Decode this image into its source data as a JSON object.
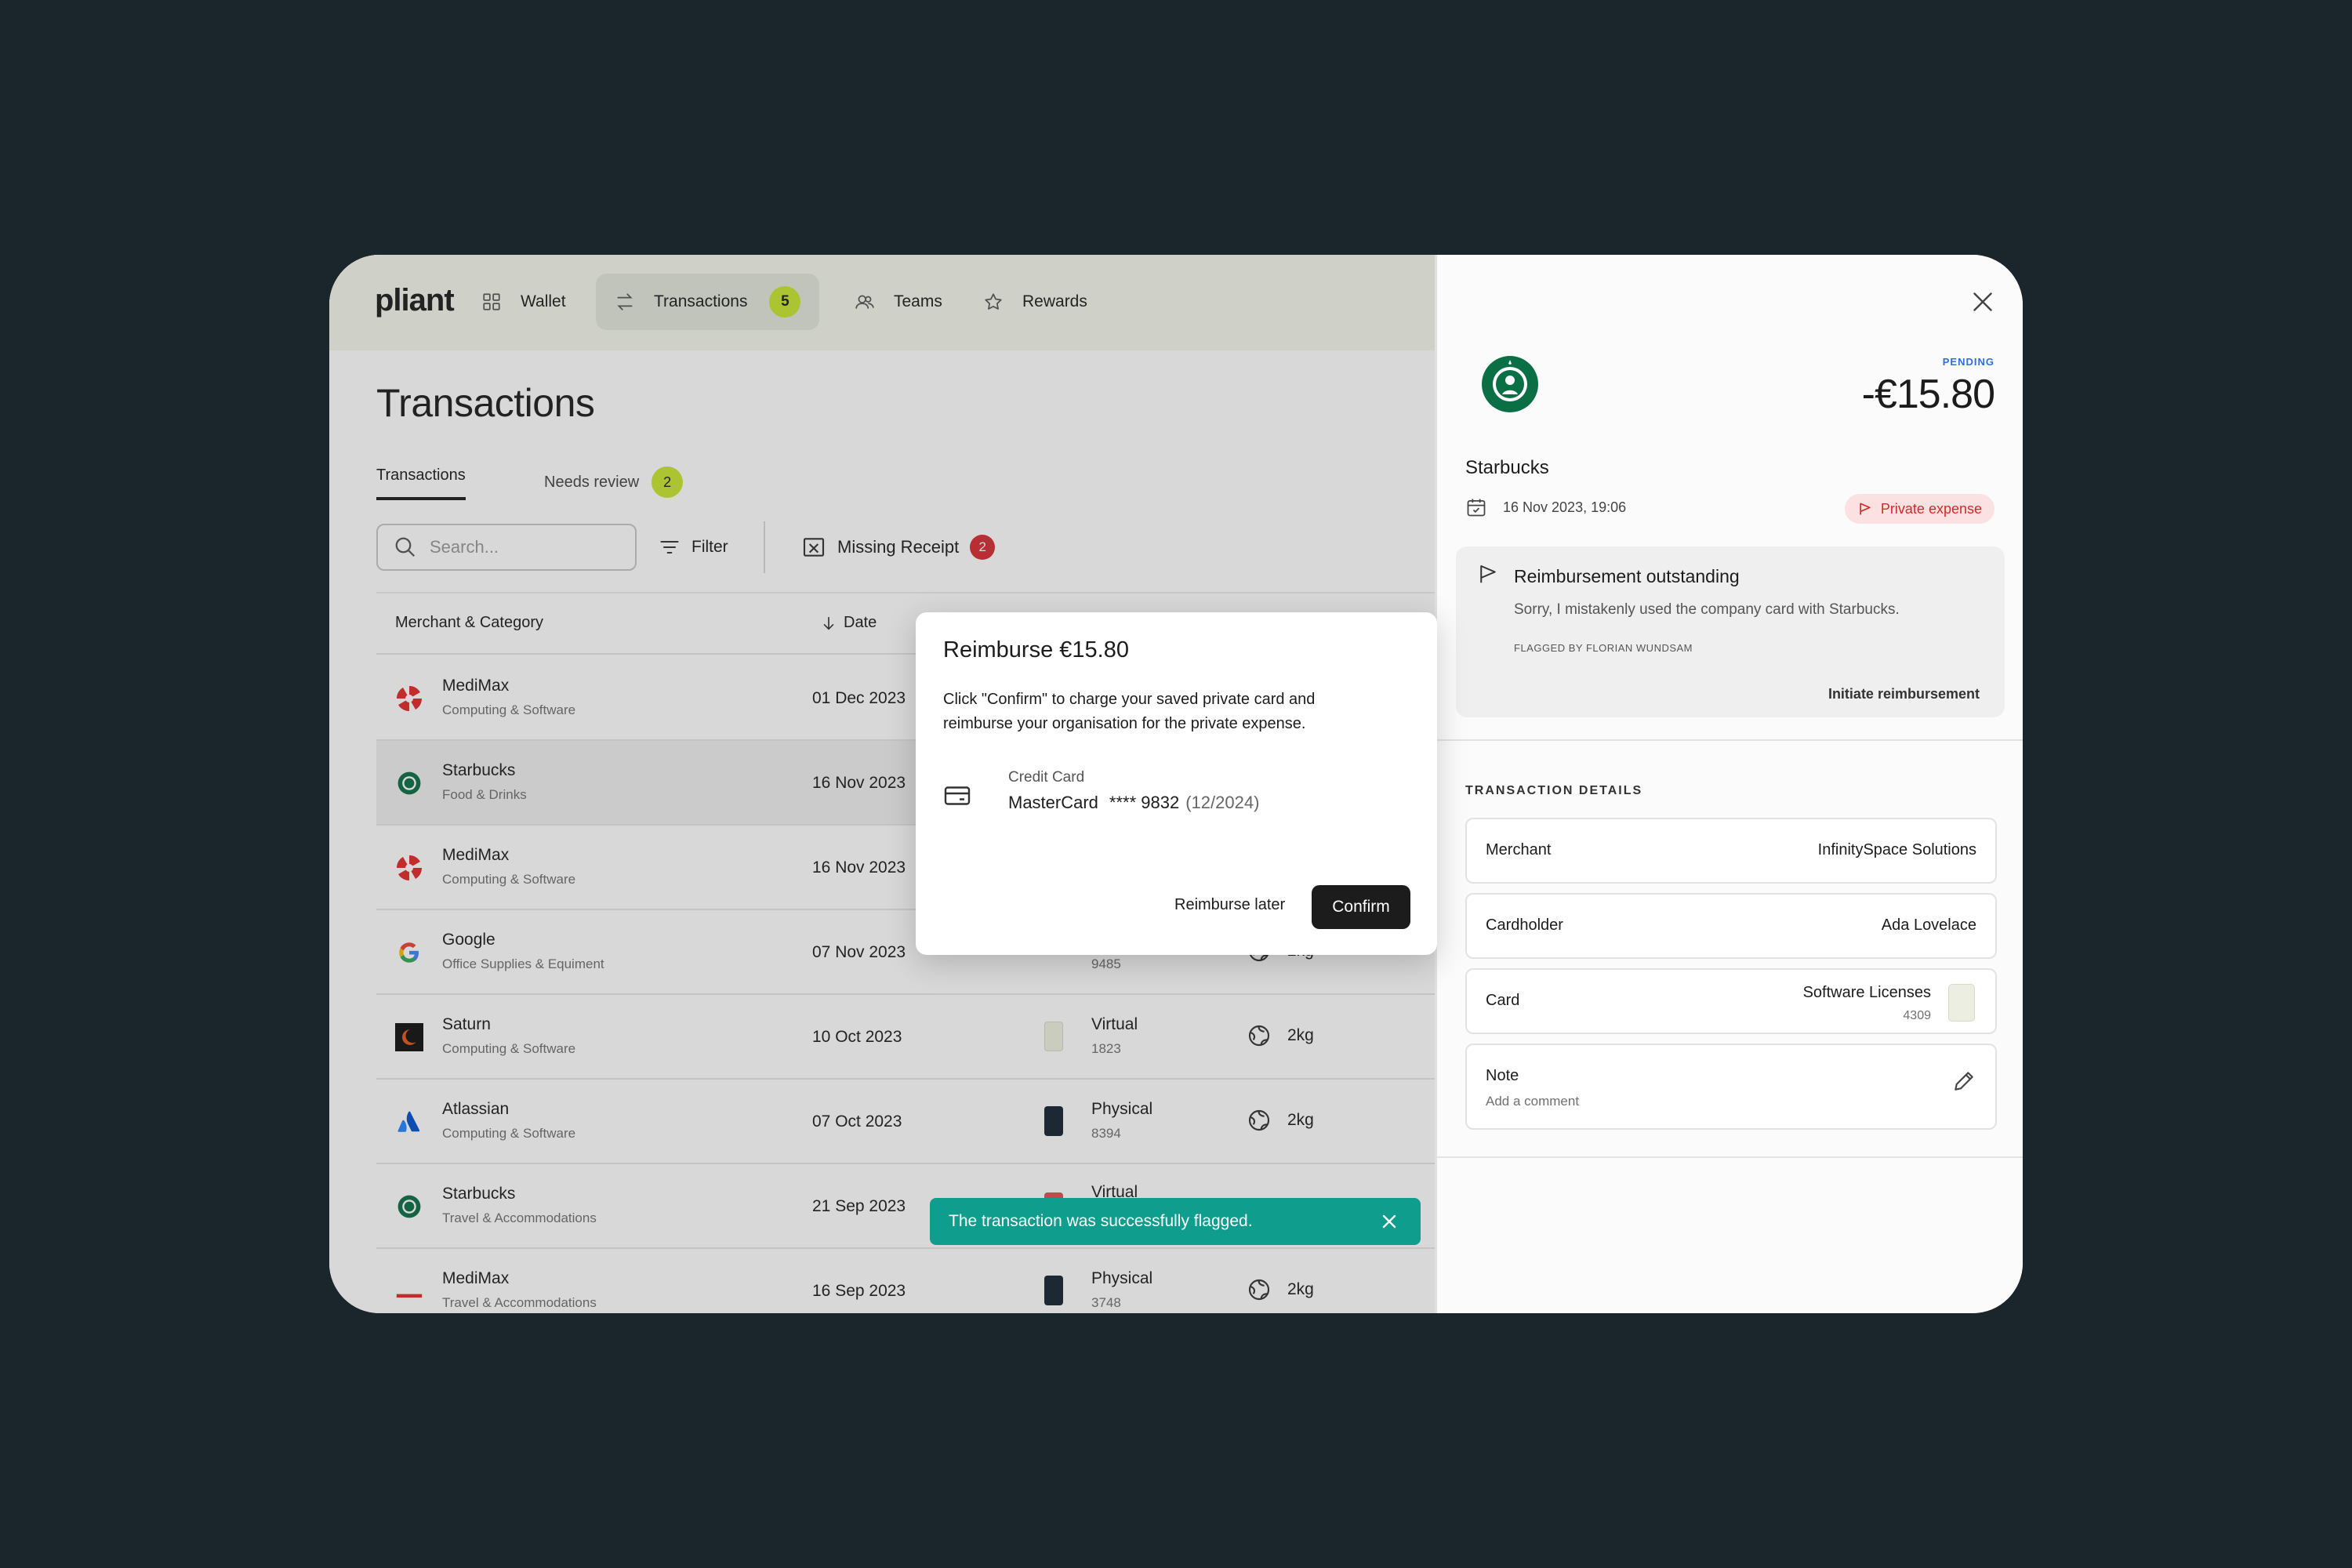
{
  "brand": "pliant",
  "nav": [
    {
      "label": "Wallet",
      "icon": "grid-icon"
    },
    {
      "label": "Transactions",
      "icon": "arrows-swap-icon",
      "badge": "5",
      "active": true
    },
    {
      "label": "Teams",
      "icon": "users-icon"
    },
    {
      "label": "Rewards",
      "icon": "star-icon"
    }
  ],
  "page": {
    "title": "Transactions",
    "tabs": {
      "transactions": "Transactions",
      "needs_review": "Needs review",
      "needs_review_count": "2"
    },
    "search_placeholder": "Search...",
    "filter_label": "Filter",
    "missing_receipt_label": "Missing Receipt",
    "missing_receipt_count": "2"
  },
  "table": {
    "headers": {
      "merchant": "Merchant & Category",
      "date": "Date"
    },
    "rows": [
      {
        "merchant": "MediMax",
        "category": "Computing & Software",
        "date": "01 Dec 2023",
        "card_type": "",
        "card_num": "",
        "co2": ""
      },
      {
        "merchant": "Starbucks",
        "category": "Food & Drinks",
        "date": "16 Nov 2023",
        "card_type": "",
        "card_num": "",
        "co2": ""
      },
      {
        "merchant": "MediMax",
        "category": "Computing & Software",
        "date": "16 Nov 2023",
        "card_type": "",
        "card_num": "",
        "co2": ""
      },
      {
        "merchant": "Google",
        "category": "Office Supplies & Equiment",
        "date": "07 Nov 2023",
        "card_type": "",
        "card_num": "9485",
        "co2": "2kg"
      },
      {
        "merchant": "Saturn",
        "category": "Computing & Software",
        "date": "10 Oct 2023",
        "card_type": "Virtual",
        "card_num": "1823",
        "co2": "2kg"
      },
      {
        "merchant": "Atlassian",
        "category": "Computing & Software",
        "date": "07 Oct 2023",
        "card_type": "Physical",
        "card_num": "8394",
        "co2": "2kg"
      },
      {
        "merchant": "Starbucks",
        "category": "Travel & Accommodations",
        "date": "21 Sep 2023",
        "card_type": "Virtual",
        "card_num": "",
        "co2": ""
      },
      {
        "merchant": "MediMax",
        "category": "Travel & Accommodations",
        "date": "16 Sep 2023",
        "card_type": "Physical",
        "card_num": "3748",
        "co2": "2kg"
      }
    ]
  },
  "detail": {
    "status": "PENDING",
    "amount": "-€15.80",
    "merchant": "Starbucks",
    "datetime": "16 Nov 2023, 19:06",
    "tag": "Private expense",
    "reimbursement": {
      "title": "Reimbursement outstanding",
      "message": "Sorry, I mistakenly used the company card with Starbucks.",
      "flagged_by": "FLAGGED BY FLORIAN WUNDSAM",
      "action": "Initiate reimbursement"
    },
    "section_title": "TRANSACTION DETAILS",
    "fields": {
      "merchant_label": "Merchant",
      "merchant_value": "InfinitySpace Solutions",
      "cardholder_label": "Cardholder",
      "cardholder_value": "Ada Lovelace",
      "card_label": "Card",
      "card_value": "Software Licenses",
      "card_num": "4309",
      "note_label": "Note",
      "note_placeholder": "Add a comment"
    }
  },
  "modal": {
    "title": "Reimburse €15.80",
    "body": "Click \"Confirm\" to charge your saved private card and reimburse your organisation for the private expense.",
    "card_label": "Credit Card",
    "card_brand": "MasterCard",
    "card_masked": "**** 9832",
    "card_expiry": "(12/2024)",
    "later_label": "Reimburse later",
    "confirm_label": "Confirm"
  },
  "toast": {
    "message": "The transaction was successfully flagged."
  },
  "colors": {
    "accent_lime": "#c8e630",
    "danger": "#d92a32",
    "toast": "#0f9d8d",
    "pending": "#2f6fdc"
  }
}
